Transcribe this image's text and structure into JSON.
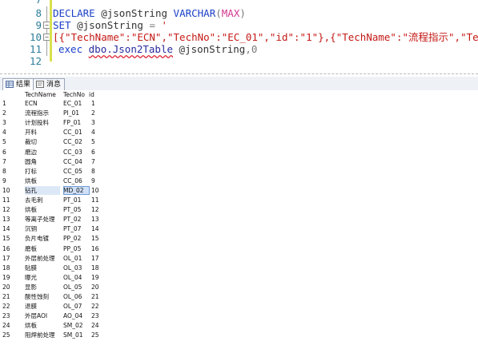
{
  "editor": {
    "line_numbers": [
      "7",
      "8",
      "9",
      "10",
      "11",
      "12"
    ],
    "line8": {
      "declare": "DECLARE",
      "var": "@jsonString",
      "type": "VARCHAR",
      "open": "(",
      "max": "MAX",
      "close": ")"
    },
    "line9": {
      "set": "SET",
      "var": "@jsonString",
      "eq": "=",
      "quote": "'"
    },
    "line10": {
      "json": "[{\"TechName\":\"ECN\",\"TechNo\":\"EC_01\",\"id\":\"1\"},{\"TechName\":\"流程指示\",\"TechN"
    },
    "line11": {
      "exec": "exec",
      "proc": "dbo.Json2Table",
      "var": "@jsonString",
      "arg": ",0"
    }
  },
  "tabs": [
    {
      "label": "结果",
      "icon": "grid-icon"
    },
    {
      "label": "消息",
      "icon": "message-icon"
    }
  ],
  "grid": {
    "headers": [
      "TechName",
      "TechNo",
      "id"
    ],
    "selected_row": 10,
    "rows": [
      {
        "n": "1",
        "name": "ECN",
        "no": "EC_01",
        "id": "1"
      },
      {
        "n": "2",
        "name": "流程指示",
        "no": "PI_01",
        "id": "2"
      },
      {
        "n": "3",
        "name": "计划投料",
        "no": "FP_01",
        "id": "3"
      },
      {
        "n": "4",
        "name": "开料",
        "no": "CC_01",
        "id": "4"
      },
      {
        "n": "5",
        "name": "裁切",
        "no": "CC_02",
        "id": "5"
      },
      {
        "n": "6",
        "name": "磨边",
        "no": "CC_03",
        "id": "6"
      },
      {
        "n": "7",
        "name": "圆角",
        "no": "CC_04",
        "id": "7"
      },
      {
        "n": "8",
        "name": "打标",
        "no": "CC_05",
        "id": "8"
      },
      {
        "n": "9",
        "name": "烘板",
        "no": "CC_06",
        "id": "9"
      },
      {
        "n": "10",
        "name": "钻孔",
        "no": "MD_02",
        "id": "10"
      },
      {
        "n": "11",
        "name": "去毛刺",
        "no": "PT_01",
        "id": "11"
      },
      {
        "n": "12",
        "name": "烘板",
        "no": "PT_05",
        "id": "12"
      },
      {
        "n": "13",
        "name": "等离子处理",
        "no": "PT_02",
        "id": "13"
      },
      {
        "n": "14",
        "name": "沉铜",
        "no": "PT_07",
        "id": "14"
      },
      {
        "n": "15",
        "name": "负片电镀",
        "no": "PP_02",
        "id": "15"
      },
      {
        "n": "16",
        "name": "磨板",
        "no": "PP_05",
        "id": "16"
      },
      {
        "n": "17",
        "name": "外层前处理",
        "no": "OL_01",
        "id": "17"
      },
      {
        "n": "18",
        "name": "贴膜",
        "no": "OL_03",
        "id": "18"
      },
      {
        "n": "19",
        "name": "曝光",
        "no": "OL_04",
        "id": "19"
      },
      {
        "n": "20",
        "name": "显影",
        "no": "OL_05",
        "id": "20"
      },
      {
        "n": "21",
        "name": "酸性蚀刻",
        "no": "OL_06",
        "id": "21"
      },
      {
        "n": "22",
        "name": "退膜",
        "no": "OL_07",
        "id": "22"
      },
      {
        "n": "23",
        "name": "外层AOI",
        "no": "AO_04",
        "id": "23"
      },
      {
        "n": "24",
        "name": "烘板",
        "no": "SM_02",
        "id": "24"
      },
      {
        "n": "25",
        "name": "阻焊前处理",
        "no": "SM_01",
        "id": "25"
      }
    ]
  }
}
